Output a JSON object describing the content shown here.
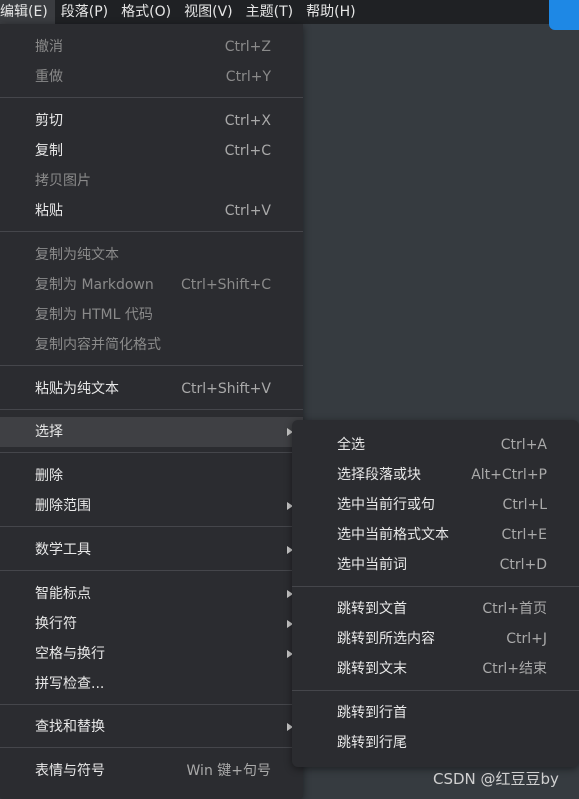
{
  "menubar": {
    "items": [
      "编辑(E)",
      "段落(P)",
      "格式(O)",
      "视图(V)",
      "主题(T)",
      "帮助(H)"
    ]
  },
  "menu": {
    "items": [
      {
        "label": "撤消",
        "shortcut": "Ctrl+Z",
        "disabled": true
      },
      {
        "label": "重做",
        "shortcut": "Ctrl+Y",
        "disabled": true
      },
      {
        "label": "剪切",
        "shortcut": "Ctrl+X"
      },
      {
        "label": "复制",
        "shortcut": "Ctrl+C"
      },
      {
        "label": "拷贝图片",
        "shortcut": "",
        "disabled": true
      },
      {
        "label": "粘贴",
        "shortcut": "Ctrl+V"
      },
      {
        "label": "复制为纯文本",
        "shortcut": "",
        "disabled": true
      },
      {
        "label": "复制为 Markdown",
        "shortcut": "Ctrl+Shift+C",
        "disabled": true
      },
      {
        "label": "复制为 HTML 代码",
        "shortcut": "",
        "disabled": true
      },
      {
        "label": "复制内容并简化格式",
        "shortcut": "",
        "disabled": true
      },
      {
        "label": "粘贴为纯文本",
        "shortcut": "Ctrl+Shift+V"
      },
      {
        "label": "选择",
        "shortcut": "",
        "submenu": true,
        "selected": true
      },
      {
        "label": "删除",
        "shortcut": ""
      },
      {
        "label": "删除范围",
        "shortcut": "",
        "submenu": true
      },
      {
        "label": "数学工具",
        "shortcut": "",
        "submenu": true
      },
      {
        "label": "智能标点",
        "shortcut": "",
        "submenu": true
      },
      {
        "label": "换行符",
        "shortcut": "",
        "submenu": true
      },
      {
        "label": "空格与换行",
        "shortcut": "",
        "submenu": true
      },
      {
        "label": "拼写检查...",
        "shortcut": ""
      },
      {
        "label": "查找和替换",
        "shortcut": "",
        "submenu": true
      },
      {
        "label": "表情与符号",
        "shortcut": "Win 键+句号"
      }
    ]
  },
  "submenu": {
    "items": [
      {
        "label": "全选",
        "shortcut": "Ctrl+A"
      },
      {
        "label": "选择段落或块",
        "shortcut": "Alt+Ctrl+P"
      },
      {
        "label": "选中当前行或句",
        "shortcut": "Ctrl+L"
      },
      {
        "label": "选中当前格式文本",
        "shortcut": "Ctrl+E"
      },
      {
        "label": "选中当前词",
        "shortcut": "Ctrl+D"
      },
      {
        "label": "跳转到文首",
        "shortcut": "Ctrl+首页"
      },
      {
        "label": "跳转到所选内容",
        "shortcut": "Ctrl+J"
      },
      {
        "label": "跳转到文末",
        "shortcut": "Ctrl+结束"
      },
      {
        "label": "跳转到行首",
        "shortcut": ""
      },
      {
        "label": "跳转到行尾",
        "shortcut": ""
      }
    ]
  },
  "watermark": "CSDN @红豆豆by",
  "colors": {
    "menubar": "#1f2124",
    "menu": "#2b2c30",
    "selected": "#3f4044",
    "editor": "#363b40",
    "accent": "#1e88e5"
  }
}
